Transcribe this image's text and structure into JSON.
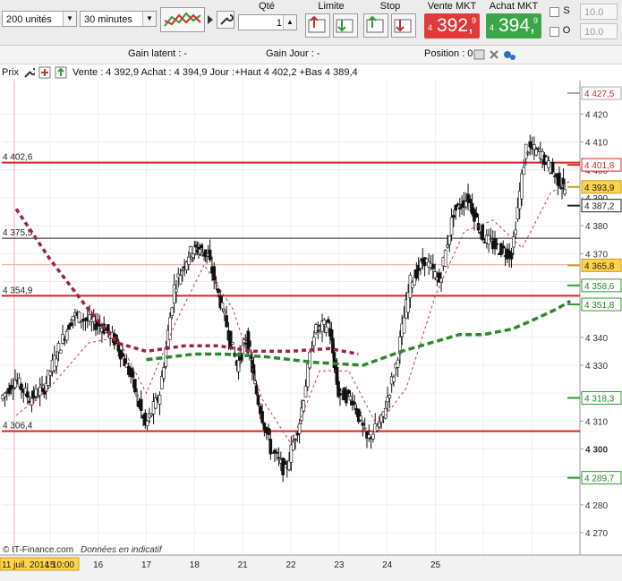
{
  "toolbar": {
    "units_value": "200 unités",
    "period_value": "30 minutes",
    "qty_label": "Qté",
    "qty_value": "1",
    "limit_label": "Limite",
    "stop_label": "Stop",
    "sell_label": "Vente MKT",
    "buy_label": "Achat MKT",
    "sell_price_prefix": "4",
    "sell_price_main": "392,",
    "sell_price_sup": "9",
    "buy_price_prefix": "4",
    "buy_price_main": "394,",
    "buy_price_sup": "9",
    "s_label": "S",
    "o_label": "O",
    "s_value": "10.0",
    "o_value": "10.0",
    "sell_color": "#e03a3a",
    "buy_color": "#3aa648"
  },
  "info": {
    "gain_latent": "Gain latent : -",
    "gain_jour": "Gain Jour : -",
    "position": "Position : 0"
  },
  "legend": {
    "prefix": "Prix",
    "text": "Vente : 4 392,9 Achat : 4 394,9 Jour :+Haut 4 402,2 +Bas 4 389,4"
  },
  "chart_data": {
    "type": "candlestick",
    "instrument_timeframe": "30 minutes",
    "ylim": [
      4262,
      4432
    ],
    "y_ticks": [
      4270,
      4280,
      4290,
      4300,
      4310,
      4320,
      4330,
      4340,
      4350,
      4360,
      4370,
      4380,
      4390,
      4400,
      4410,
      4420
    ],
    "y_tick_labels": [
      "4 270",
      "4 280",
      "",
      "4 300",
      "4 310",
      "",
      "4 330",
      "4 340",
      "",
      "4 360",
      "4 370",
      "4 380",
      "4 390",
      "4 400",
      "4 410",
      "4 420"
    ],
    "x_labels": [
      "11 juil. 2014 10:00",
      "15",
      "16",
      "17",
      "18",
      "21",
      "22",
      "23",
      "24",
      "25"
    ],
    "horizontal_lines": [
      {
        "value": 4402.6,
        "label": "4 402,6",
        "color": "#e02020",
        "width": 2
      },
      {
        "value": 4375.5,
        "label": "4 375,5",
        "color": "#222222",
        "width": 1
      },
      {
        "value": 4354.9,
        "label": "4 354,9",
        "color": "#e02020",
        "width": 2
      },
      {
        "value": 4306.4,
        "label": "4 306,4",
        "color": "#e02020",
        "width": 2
      },
      {
        "value": 4366.0,
        "label": "",
        "color": "#e8a0a0",
        "width": 1
      }
    ],
    "price_tags": [
      {
        "value": 4427.5,
        "label": "4 427,5",
        "bg": "#ffffff",
        "border": "#aaaaaa",
        "fg": "#c03030"
      },
      {
        "value": 4401.8,
        "label": "4 401,8",
        "bg": "#ffffff",
        "border": "#e02020",
        "fg": "#c03030"
      },
      {
        "value": 4393.9,
        "label": "4 393,9",
        "bg": "#ffd24a",
        "border": "#c9a020",
        "fg": "#222222"
      },
      {
        "value": 4387.2,
        "label": "4 387,2",
        "bg": "#ffffff",
        "border": "#222222",
        "fg": "#222222"
      },
      {
        "value": 4365.8,
        "label": "4 365,8",
        "bg": "#ffd24a",
        "border": "#c9a020",
        "fg": "#222222"
      },
      {
        "value": 4358.6,
        "label": "4 358,6",
        "bg": "#ffffff",
        "border": "#2e9e2e",
        "fg": "#2e7e2e"
      },
      {
        "value": 4351.8,
        "label": "4 351,8",
        "bg": "#ffffff",
        "border": "#2e9e2e",
        "fg": "#2e7e2e"
      },
      {
        "value": 4318.3,
        "label": "4 318,3",
        "bg": "#ffffff",
        "border": "#2e9e2e",
        "fg": "#2e7e2e"
      },
      {
        "value": 4289.7,
        "label": "4 289,7",
        "bg": "#ffffff",
        "border": "#2e9e2e",
        "fg": "#2e7e2e"
      }
    ],
    "close_series": [
      {
        "x": 0.0,
        "y": 4318
      },
      {
        "x": 0.3,
        "y": 4325
      },
      {
        "x": 0.6,
        "y": 4318
      },
      {
        "x": 0.9,
        "y": 4322
      },
      {
        "x": 1.2,
        "y": 4336
      },
      {
        "x": 1.5,
        "y": 4348
      },
      {
        "x": 1.8,
        "y": 4346
      },
      {
        "x": 2.1,
        "y": 4344
      },
      {
        "x": 2.4,
        "y": 4338
      },
      {
        "x": 2.7,
        "y": 4326
      },
      {
        "x": 3.0,
        "y": 4308
      },
      {
        "x": 3.3,
        "y": 4320
      },
      {
        "x": 3.6,
        "y": 4358
      },
      {
        "x": 3.9,
        "y": 4370
      },
      {
        "x": 4.1,
        "y": 4372
      },
      {
        "x": 4.3,
        "y": 4369
      },
      {
        "x": 4.6,
        "y": 4350
      },
      {
        "x": 4.9,
        "y": 4330
      },
      {
        "x": 5.1,
        "y": 4340
      },
      {
        "x": 5.3,
        "y": 4320
      },
      {
        "x": 5.6,
        "y": 4300
      },
      {
        "x": 5.9,
        "y": 4292
      },
      {
        "x": 6.2,
        "y": 4310
      },
      {
        "x": 6.5,
        "y": 4342
      },
      {
        "x": 6.8,
        "y": 4345
      },
      {
        "x": 7.0,
        "y": 4320
      },
      {
        "x": 7.3,
        "y": 4318
      },
      {
        "x": 7.6,
        "y": 4303
      },
      {
        "x": 7.9,
        "y": 4310
      },
      {
        "x": 8.2,
        "y": 4330
      },
      {
        "x": 8.5,
        "y": 4360
      },
      {
        "x": 8.8,
        "y": 4368
      },
      {
        "x": 9.1,
        "y": 4360
      },
      {
        "x": 9.4,
        "y": 4385
      },
      {
        "x": 9.7,
        "y": 4390
      },
      {
        "x": 10.0,
        "y": 4376
      },
      {
        "x": 10.3,
        "y": 4372
      },
      {
        "x": 10.6,
        "y": 4370
      },
      {
        "x": 10.9,
        "y": 4408
      },
      {
        "x": 11.2,
        "y": 4406
      },
      {
        "x": 11.5,
        "y": 4398
      },
      {
        "x": 11.7,
        "y": 4393
      }
    ],
    "ma_red": [
      {
        "x": 0.3,
        "y": 4386
      },
      {
        "x": 1.0,
        "y": 4368
      },
      {
        "x": 1.8,
        "y": 4350
      },
      {
        "x": 2.4,
        "y": 4338
      },
      {
        "x": 3.0,
        "y": 4335
      },
      {
        "x": 3.8,
        "y": 4337
      },
      {
        "x": 4.5,
        "y": 4337
      },
      {
        "x": 5.2,
        "y": 4335
      },
      {
        "x": 6.0,
        "y": 4335
      },
      {
        "x": 6.8,
        "y": 4336
      },
      {
        "x": 7.4,
        "y": 4334
      }
    ],
    "ma_green": [
      {
        "x": 3.0,
        "y": 4332
      },
      {
        "x": 4.0,
        "y": 4334
      },
      {
        "x": 4.6,
        "y": 4334
      },
      {
        "x": 5.5,
        "y": 4333
      },
      {
        "x": 6.5,
        "y": 4331
      },
      {
        "x": 7.5,
        "y": 4330
      },
      {
        "x": 8.3,
        "y": 4335
      },
      {
        "x": 8.9,
        "y": 4338
      },
      {
        "x": 9.5,
        "y": 4341
      },
      {
        "x": 10.0,
        "y": 4341
      },
      {
        "x": 10.6,
        "y": 4343
      },
      {
        "x": 11.0,
        "y": 4346
      },
      {
        "x": 11.5,
        "y": 4350
      },
      {
        "x": 11.8,
        "y": 4353
      }
    ],
    "ma_fast_dashed": [
      {
        "x": 0.3,
        "y": 4312
      },
      {
        "x": 1.0,
        "y": 4322
      },
      {
        "x": 1.8,
        "y": 4338
      },
      {
        "x": 2.4,
        "y": 4340
      },
      {
        "x": 3.0,
        "y": 4320
      },
      {
        "x": 3.6,
        "y": 4345
      },
      {
        "x": 4.2,
        "y": 4366
      },
      {
        "x": 4.8,
        "y": 4350
      },
      {
        "x": 5.4,
        "y": 4318
      },
      {
        "x": 6.0,
        "y": 4302
      },
      {
        "x": 6.6,
        "y": 4328
      },
      {
        "x": 7.2,
        "y": 4328
      },
      {
        "x": 7.8,
        "y": 4308
      },
      {
        "x": 8.4,
        "y": 4322
      },
      {
        "x": 9.0,
        "y": 4355
      },
      {
        "x": 9.6,
        "y": 4378
      },
      {
        "x": 10.2,
        "y": 4382
      },
      {
        "x": 10.8,
        "y": 4372
      },
      {
        "x": 11.4,
        "y": 4392
      },
      {
        "x": 11.8,
        "y": 4396
      }
    ],
    "credit": "© IT-Finance.com",
    "credit_note": "Données en indicatif"
  }
}
